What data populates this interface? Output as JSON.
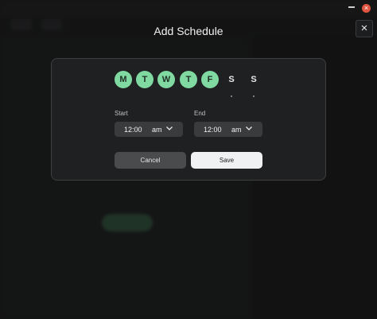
{
  "sheet": {
    "title": "Add Schedule",
    "close_glyph": "×"
  },
  "days": [
    {
      "label": "M",
      "selected": true
    },
    {
      "label": "T",
      "selected": true
    },
    {
      "label": "W",
      "selected": true
    },
    {
      "label": "T",
      "selected": true
    },
    {
      "label": "F",
      "selected": true
    },
    {
      "label": "S",
      "selected": false
    },
    {
      "label": "S",
      "selected": false
    }
  ],
  "start": {
    "label": "Start",
    "time": "12:00",
    "ampm": "am"
  },
  "end": {
    "label": "End",
    "time": "12:00",
    "ampm": "am"
  },
  "buttons": {
    "cancel": "Cancel",
    "save": "Save"
  },
  "window": {
    "close_glyph": "×"
  },
  "colors": {
    "accent": "#7fd9a0",
    "close": "#e0553f",
    "save_bg": "#f0f1f2",
    "cancel_bg": "#4a4b4d"
  }
}
